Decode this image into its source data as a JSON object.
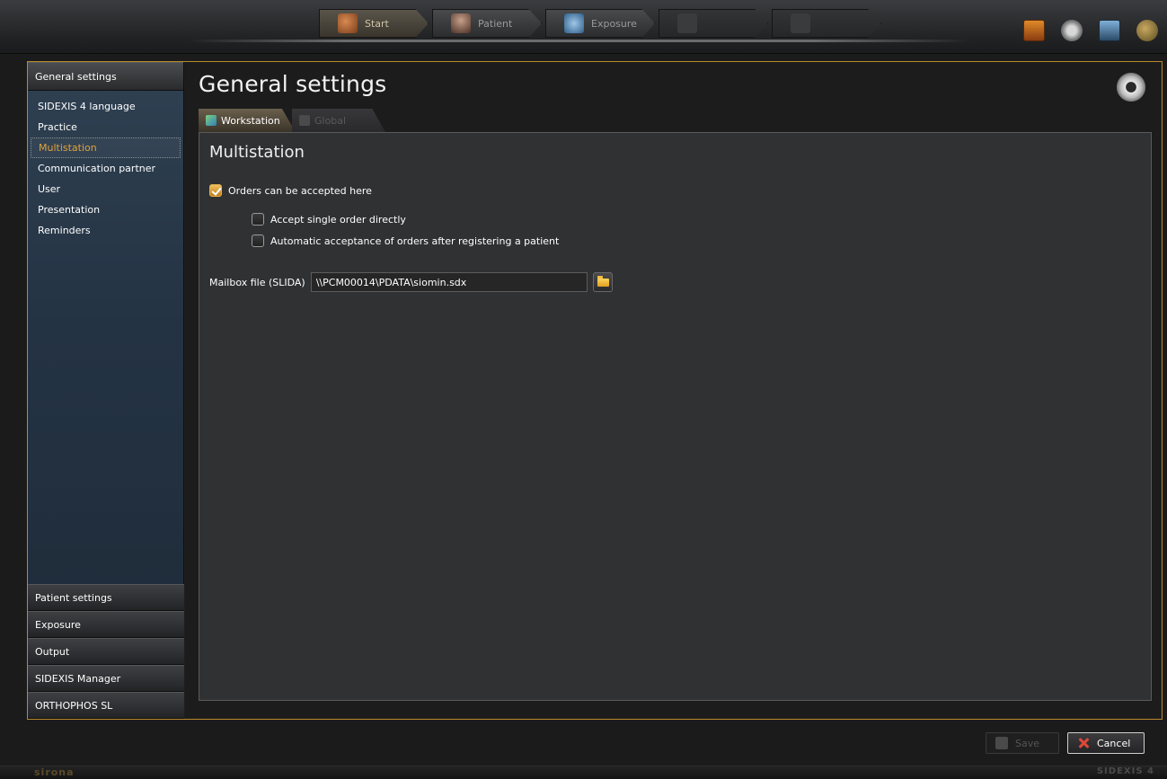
{
  "nav": {
    "steps": [
      {
        "label": "Start",
        "icon": "house-icon",
        "state": "active"
      },
      {
        "label": "Patient",
        "icon": "patient-icon",
        "state": "normal"
      },
      {
        "label": "Exposure",
        "icon": "exposure-icon",
        "state": "normal"
      },
      {
        "label": "",
        "icon": "examination-icon",
        "state": "disabled"
      },
      {
        "label": "",
        "icon": "output-icon",
        "state": "disabled"
      }
    ],
    "right_icons": [
      "help-book-icon",
      "settings-gear-icon",
      "monitor-icon",
      "globe-icon"
    ]
  },
  "sidebar": {
    "header": "General settings",
    "items": [
      {
        "label": "SIDEXIS 4 language",
        "active": false
      },
      {
        "label": "Practice",
        "active": false
      },
      {
        "label": "Multistation",
        "active": true
      },
      {
        "label": "Communication partner",
        "active": false
      },
      {
        "label": "User",
        "active": false
      },
      {
        "label": "Presentation",
        "active": false
      },
      {
        "label": "Reminders",
        "active": false
      }
    ],
    "sections": [
      {
        "label": "Patient settings"
      },
      {
        "label": "Exposure"
      },
      {
        "label": "Output"
      },
      {
        "label": "SIDEXIS Manager"
      },
      {
        "label": "ORTHOPHOS SL"
      }
    ]
  },
  "main": {
    "title": "General settings",
    "tabs": [
      {
        "label": "Workstation",
        "active": true
      },
      {
        "label": "Global",
        "active": false
      }
    ],
    "section_title": "Multistation",
    "options": {
      "accept_orders": {
        "label": "Orders can be accepted here",
        "checked": true
      },
      "single_order": {
        "label": "Accept single order directly",
        "checked": false
      },
      "auto_accept": {
        "label": "Automatic acceptance of orders after registering a patient",
        "checked": false
      }
    },
    "mailbox": {
      "label": "Mailbox file (SLIDA)",
      "value": "\\\\PCM00014\\PDATA\\siomin.sdx"
    }
  },
  "footer": {
    "save_label": "Save",
    "cancel_label": "Cancel"
  },
  "status": {
    "brand_left": "sirona",
    "brand_right": "SIDEXIS 4"
  },
  "colors": {
    "accent": "#e3a13a",
    "frame_border": "#b88a2c",
    "sidebar_bg": "#243344",
    "panel_bg": "#303133"
  }
}
